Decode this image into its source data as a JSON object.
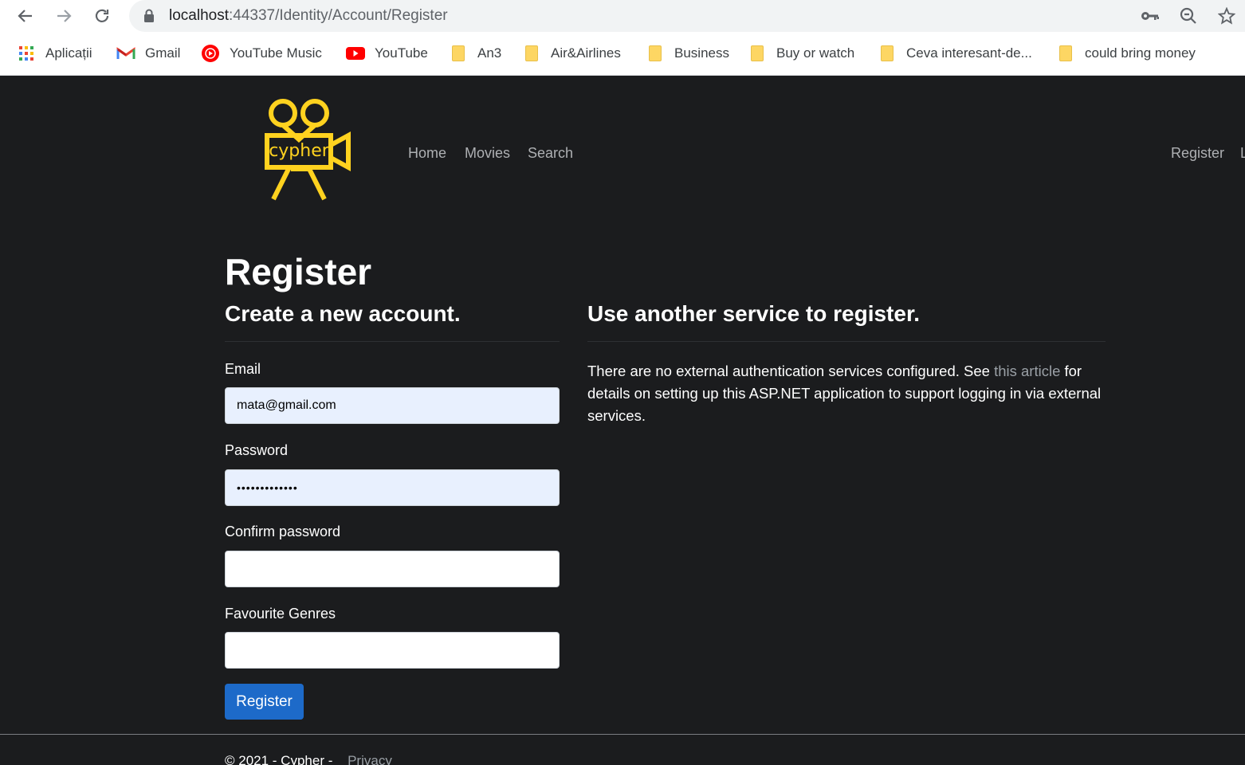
{
  "browser": {
    "url_host": "localhost",
    "url_rest": ":44337/Identity/Account/Register",
    "bookmarks": [
      {
        "label": "Aplicații",
        "icon": "apps-grid-icon"
      },
      {
        "label": "Gmail",
        "icon": "gmail-icon"
      },
      {
        "label": "YouTube Music",
        "icon": "youtube-music-icon"
      },
      {
        "label": "YouTube",
        "icon": "youtube-icon"
      },
      {
        "label": "An3",
        "icon": "folder-icon"
      },
      {
        "label": "Air&Airlines",
        "icon": "folder-icon"
      },
      {
        "label": "Business",
        "icon": "folder-icon"
      },
      {
        "label": "Buy or watch",
        "icon": "folder-icon"
      },
      {
        "label": "Ceva interesant-de...",
        "icon": "folder-icon"
      },
      {
        "label": "could bring money",
        "icon": "folder-icon"
      }
    ]
  },
  "site": {
    "logo_text": "cypher",
    "brand_color": "#ffd21f",
    "nav": {
      "home": "Home",
      "movies": "Movies",
      "search": "Search",
      "register": "Register",
      "login_partial": "L"
    }
  },
  "page": {
    "title": "Register",
    "left_heading": "Create a new account.",
    "right_heading": "Use another service to register.",
    "form": {
      "email_label": "Email",
      "email_value": "mata@gmail.com",
      "password_label": "Password",
      "password_value": "•••••••••••••",
      "confirm_label": "Confirm password",
      "confirm_value": "",
      "genres_label": "Favourite Genres",
      "genres_value": "",
      "submit_label": "Register"
    },
    "external": {
      "text_before": "There are no external authentication services configured. See ",
      "link_text": "this article",
      "text_after": " for details on setting up this ASP.NET application to support logging in via external services."
    }
  },
  "footer": {
    "copyright": "© 2021 - Cypher - ",
    "privacy": "Privacy"
  }
}
